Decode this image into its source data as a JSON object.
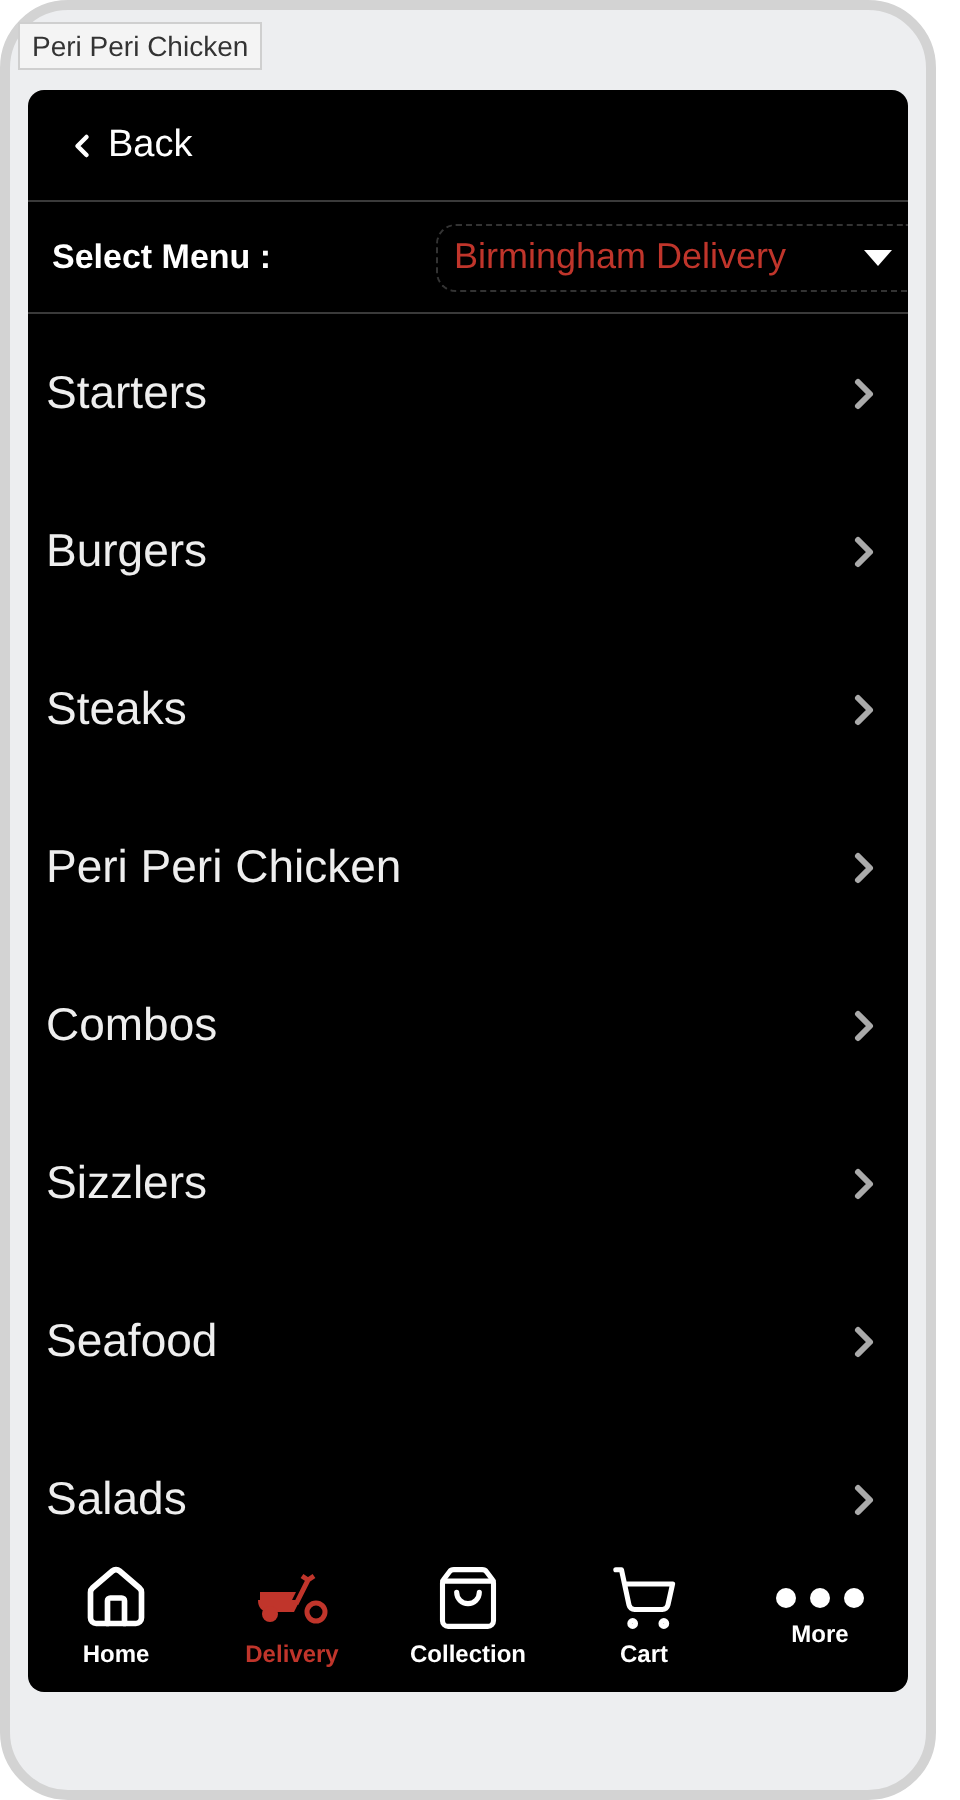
{
  "tooltip": "Peri Peri Chicken",
  "header": {
    "back": "Back"
  },
  "menu_select": {
    "label": "Select Menu :",
    "value": "Birmingham Delivery"
  },
  "categories": [
    {
      "label": "Starters"
    },
    {
      "label": "Burgers"
    },
    {
      "label": "Steaks"
    },
    {
      "label": "Peri Peri Chicken"
    },
    {
      "label": "Combos"
    },
    {
      "label": "Sizzlers"
    },
    {
      "label": "Seafood"
    },
    {
      "label": "Salads"
    }
  ],
  "tabs": [
    {
      "label": "Home",
      "selected": false
    },
    {
      "label": "Delivery",
      "selected": true
    },
    {
      "label": "Collection",
      "selected": false
    },
    {
      "label": "Cart",
      "selected": false
    },
    {
      "label": "More",
      "selected": false
    }
  ]
}
